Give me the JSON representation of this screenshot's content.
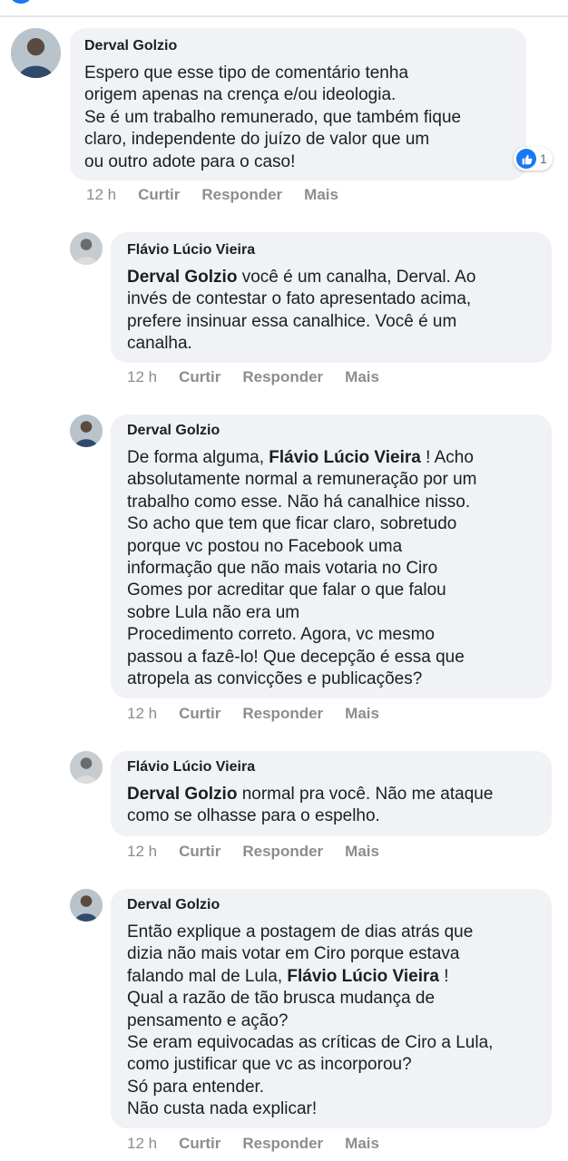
{
  "comments": [
    {
      "author": "Derval Golzio",
      "lines": [
        "Espero que esse tipo de comentário tenha",
        "origem apenas na crença e/ou ideologia.",
        "Se é um trabalho remunerado, que também fique",
        "claro, independente do juízo de valor que um",
        "ou outro adote para o caso!"
      ],
      "reaction_count": "1",
      "time": "12 h"
    },
    {
      "author": "Flávio Lúcio Vieira",
      "mention": "Derval Golzio",
      "lines": [
        " você é um canalha, Derval. Ao",
        "invés de contestar o fato apresentado acima,",
        "prefere insinuar essa canalhice. Você é um",
        "canalha."
      ],
      "time": "12 h"
    },
    {
      "author": "Derval Golzio",
      "line1_before": "De forma alguma, ",
      "mention": "Flávio Lúcio Vieira",
      "line1_after": " ! Acho",
      "lines": [
        "absolutamente normal a remuneração por um",
        "trabalho como esse. Não há canalhice nisso.",
        "So acho que tem que ficar claro, sobretudo",
        "porque vc postou no Facebook uma",
        "informação que não mais votaria no Ciro",
        "Gomes por acreditar que falar o que falou",
        "sobre Lula não era um",
        "Procedimento correto. Agora, vc mesmo",
        "passou a fazê-lo! Que decepção é essa que",
        "atropela as convicções e publicações?"
      ],
      "time": "12 h"
    },
    {
      "author": "Flávio Lúcio Vieira",
      "mention": "Derval Golzio",
      "line1_after": " normal pra você. Não me ataque",
      "lines": [
        "como se olhasse para o espelho."
      ],
      "time": "12 h"
    },
    {
      "author": "Derval Golzio",
      "lines_before": [
        "Então explique a postagem de dias atrás que",
        "dizia não mais votar em Ciro porque estava"
      ],
      "mention_line_before": "falando mal de Lula, ",
      "mention": "Flávio Lúcio Vieira",
      "mention_line_after": " !",
      "lines": [
        "Qual a razão de tão brusca mudança de",
        "pensamento e ação?",
        "Se eram equivocadas as críticas de Ciro a Lula,",
        "como justificar que vc as incorporou?",
        "Só para entender.",
        "Não custa nada explicar!"
      ],
      "time": "12 h"
    }
  ],
  "actions": {
    "like": "Curtir",
    "reply": "Responder",
    "more": "Mais"
  },
  "colors": {
    "bubble": "#f0f2f5",
    "meta_text": "#8a8d91",
    "like_blue": "#1877f2"
  }
}
